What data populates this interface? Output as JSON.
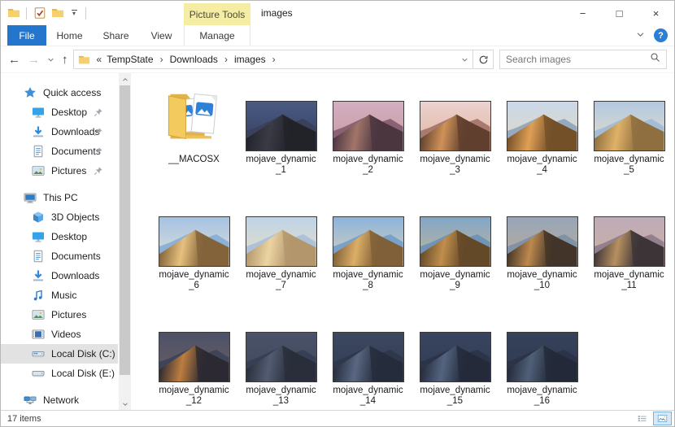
{
  "window": {
    "title": "images",
    "contextual_tab_group": "Picture Tools",
    "qat_caret": "▾",
    "controls": {
      "minimize": "−",
      "maximize": "□",
      "close": "×"
    }
  },
  "ribbon": {
    "tabs": [
      {
        "label": "File",
        "active": true
      },
      {
        "label": "Home"
      },
      {
        "label": "Share"
      },
      {
        "label": "View"
      },
      {
        "label": "Manage",
        "contextual": true
      }
    ],
    "help_glyph": "?"
  },
  "address": {
    "overflow_prefix": "«",
    "separator": "›",
    "crumbs": [
      "TempState",
      "Downloads",
      "images"
    ],
    "trailing_separator": "›"
  },
  "search": {
    "placeholder": "Search images"
  },
  "sidebar": {
    "items": [
      {
        "label": "Quick access",
        "icon": "star",
        "level": 0
      },
      {
        "label": "Desktop",
        "icon": "desktop",
        "level": 1,
        "pinned": true
      },
      {
        "label": "Downloads",
        "icon": "downloads",
        "level": 1,
        "pinned": true
      },
      {
        "label": "Documents",
        "icon": "documents",
        "level": 1,
        "pinned": true
      },
      {
        "label": "Pictures",
        "icon": "pictures",
        "level": 1,
        "pinned": true
      },
      {
        "label": "This PC",
        "icon": "this-pc",
        "level": 0,
        "group_start": true
      },
      {
        "label": "3D Objects",
        "icon": "objects3d",
        "level": 1
      },
      {
        "label": "Desktop",
        "icon": "desktop",
        "level": 1
      },
      {
        "label": "Documents",
        "icon": "documents",
        "level": 1
      },
      {
        "label": "Downloads",
        "icon": "downloads",
        "level": 1
      },
      {
        "label": "Music",
        "icon": "music",
        "level": 1
      },
      {
        "label": "Pictures",
        "icon": "pictures",
        "level": 1
      },
      {
        "label": "Videos",
        "icon": "videos",
        "level": 1
      },
      {
        "label": "Local Disk (C:)",
        "icon": "disk-c",
        "level": 1,
        "highlight": true
      },
      {
        "label": "Local Disk (E:)",
        "icon": "disk-e",
        "level": 1
      },
      {
        "label": "Network",
        "icon": "network",
        "level": 0,
        "group_start": true
      }
    ]
  },
  "files": {
    "items": [
      {
        "type": "folder",
        "name": "__MACOSX"
      },
      {
        "type": "image",
        "name": "mojave_dynamic_1",
        "colors": {
          "sky1": "#4a5a82",
          "sky2": "#333e5e",
          "ridge": "#39415c",
          "lit": "#3a3b45",
          "shade": "#22232a"
        }
      },
      {
        "type": "image",
        "name": "mojave_dynamic_2",
        "colors": {
          "sky1": "#d3aec1",
          "sky2": "#c89a9c",
          "ridge": "#8a6276",
          "lit": "#a1756a",
          "shade": "#4c3640"
        }
      },
      {
        "type": "image",
        "name": "mojave_dynamic_3",
        "colors": {
          "sky1": "#ecd2d0",
          "sky2": "#e0b49a",
          "ridge": "#a87a70",
          "lit": "#cf9258",
          "shade": "#60402e"
        }
      },
      {
        "type": "image",
        "name": "mojave_dynamic_4",
        "colors": {
          "sky1": "#c9d8e8",
          "sky2": "#e2d8c4",
          "ridge": "#96aabf",
          "lit": "#dfa055",
          "shade": "#74502a"
        }
      },
      {
        "type": "image",
        "name": "mojave_dynamic_5",
        "colors": {
          "sky1": "#b2c8e0",
          "sky2": "#e8dfc9",
          "ridge": "#a4bcd4",
          "lit": "#e0b268",
          "shade": "#8f6f40"
        }
      },
      {
        "type": "image",
        "name": "mojave_dynamic_6",
        "colors": {
          "sky1": "#a5c2e2",
          "sky2": "#e2e2d8",
          "ridge": "#8cb0d6",
          "lit": "#e6c07e",
          "shade": "#82633a"
        }
      },
      {
        "type": "image",
        "name": "mojave_dynamic_7",
        "colors": {
          "sky1": "#bed3e7",
          "sky2": "#ecdfc2",
          "ridge": "#abc2da",
          "lit": "#ecd4a2",
          "shade": "#b3966c"
        }
      },
      {
        "type": "image",
        "name": "mojave_dynamic_8",
        "colors": {
          "sky1": "#8cb4dc",
          "sky2": "#dcd2b8",
          "ridge": "#79a2ca",
          "lit": "#dcae66",
          "shade": "#806038"
        }
      },
      {
        "type": "image",
        "name": "mojave_dynamic_9",
        "colors": {
          "sky1": "#82a6c8",
          "sky2": "#c6b794",
          "ridge": "#7093b8",
          "lit": "#c08e4c",
          "shade": "#644928"
        }
      },
      {
        "type": "image",
        "name": "mojave_dynamic_10",
        "colors": {
          "sky1": "#97a6b8",
          "sky2": "#bcab98",
          "ridge": "#8191a6",
          "lit": "#bd894e",
          "shade": "#423528"
        }
      },
      {
        "type": "image",
        "name": "mojave_dynamic_11",
        "colors": {
          "sky1": "#bfacba",
          "sky2": "#caaf9e",
          "ridge": "#93808c",
          "lit": "#b69060",
          "shade": "#3d3538"
        }
      },
      {
        "type": "image",
        "name": "mojave_dynamic_12",
        "colors": {
          "sky1": "#4c5168",
          "sky2": "#6d6062",
          "ridge": "#3f4458",
          "lit": "#bd7d40",
          "shade": "#2c2a32"
        }
      },
      {
        "type": "image",
        "name": "mojave_dynamic_13",
        "colors": {
          "sky1": "#49526a",
          "sky2": "#414858",
          "ridge": "#363f54",
          "lit": "#525c72",
          "shade": "#292e3a"
        }
      },
      {
        "type": "image",
        "name": "mojave_dynamic_14",
        "colors": {
          "sky1": "#3c4860",
          "sky2": "#323c54",
          "ridge": "#2f374c",
          "lit": "#596782",
          "shade": "#262d3c"
        }
      },
      {
        "type": "image",
        "name": "mojave_dynamic_15",
        "colors": {
          "sky1": "#394460",
          "sky2": "#303b52",
          "ridge": "#2c344a",
          "lit": "#546480",
          "shade": "#242b3a"
        }
      },
      {
        "type": "image",
        "name": "mojave_dynamic_16",
        "colors": {
          "sky1": "#36425a",
          "sky2": "#2e3950",
          "ridge": "#2a3348",
          "lit": "#506078",
          "shade": "#232a38"
        }
      }
    ]
  },
  "statusbar": {
    "items_count": "17 items"
  }
}
